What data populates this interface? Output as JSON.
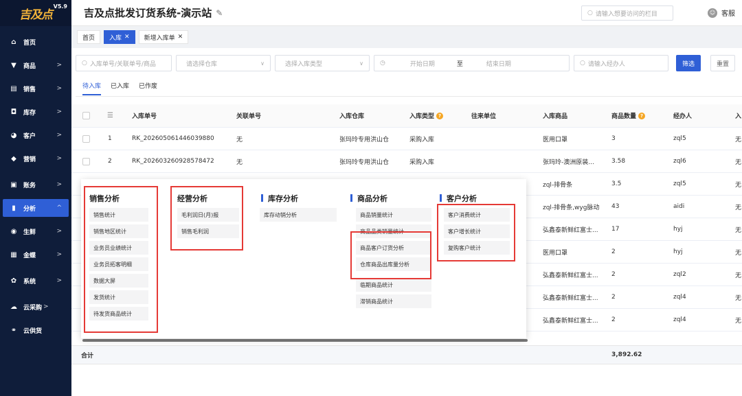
{
  "logo": {
    "text": "吉及点",
    "version": "V5.9"
  },
  "sidebar": {
    "items": [
      {
        "label": "首页",
        "icon": "home-icon",
        "glyph": "⌂"
      },
      {
        "label": "商品",
        "icon": "cart-icon",
        "glyph": "▼"
      },
      {
        "label": "销售",
        "icon": "sales-icon",
        "glyph": "▤"
      },
      {
        "label": "库存",
        "icon": "inventory-icon",
        "glyph": "◘"
      },
      {
        "label": "客户",
        "icon": "customer-icon",
        "glyph": "◕"
      },
      {
        "label": "营销",
        "icon": "marketing-icon",
        "glyph": "◆"
      },
      {
        "label": "账务",
        "icon": "ledger-icon",
        "glyph": "▣"
      },
      {
        "label": "分析",
        "icon": "chart-icon",
        "glyph": "▮"
      },
      {
        "label": "生鲜",
        "icon": "fresh-icon",
        "glyph": "◉"
      },
      {
        "label": "金蝶",
        "icon": "kingdee-icon",
        "glyph": "▦"
      },
      {
        "label": "系统",
        "icon": "gear-icon",
        "glyph": "✿"
      },
      {
        "label": "云采购",
        "icon": "cloud-icon",
        "glyph": "☁"
      },
      {
        "label": "云供货",
        "icon": "supply-icon",
        "glyph": "⚭"
      }
    ]
  },
  "header": {
    "title": "吉及点批发订货系统-演示站",
    "search_placeholder": "请输入想要访问的栏目",
    "service_label": "客服"
  },
  "tabs": [
    {
      "label": "首页"
    },
    {
      "label": "入库"
    },
    {
      "label": "新增入库单"
    }
  ],
  "filters": {
    "order_no": "入库单号/关联单号/商品",
    "warehouse": "请选择仓库",
    "in_type": "选择入库类型",
    "start_date": "开始日期",
    "date_sep": "至",
    "end_date": "结束日期",
    "operator": "请输入经办人",
    "search_btn": "筛选",
    "reset_btn": "重置"
  },
  "subtabs": [
    "待入库",
    "已入库",
    "已作废"
  ],
  "table": {
    "headers": [
      "入库单号",
      "关联单号",
      "入库仓库",
      "入库类型",
      "往来单位",
      "入库商品",
      "商品数量",
      "经办人",
      "入"
    ],
    "rows": [
      {
        "idx": "1",
        "no": "RK_202605061446039880",
        "rel": "无",
        "wh": "张玛玲专用洪山仓",
        "type": "采购入库",
        "goods": "医用口罩",
        "qty": "3",
        "op": "zql5",
        "last": "无"
      },
      {
        "idx": "2",
        "no": "RK_202603260928578472",
        "rel": "无",
        "wh": "张玛玲专用洪山仓",
        "type": "采购入库",
        "goods": "张玛玲-澳洲原装...",
        "qty": "3.58",
        "op": "zql6",
        "last": "无"
      },
      {
        "goods": "zql-排骨条",
        "qty": "3.5",
        "op": "zql5",
        "last": "无"
      },
      {
        "goods": "zql-排骨条,wyg脉动",
        "qty": "43",
        "op": "aidi",
        "last": "无"
      },
      {
        "goods": "弘鑫泰新鲜红富士...",
        "qty": "17",
        "op": "hyj",
        "last": "无"
      },
      {
        "goods": "医用口罩",
        "qty": "2",
        "op": "hyj",
        "last": "无"
      },
      {
        "goods": "弘鑫泰新鲜红富士...",
        "qty": "2",
        "op": "zql2",
        "last": "无"
      },
      {
        "goods": "弘鑫泰新鲜红富士...",
        "qty": "2",
        "op": "zql4",
        "last": "无"
      },
      {
        "goods": "弘鑫泰新鲜红富士...",
        "qty": "2",
        "op": "zql4",
        "last": "无"
      }
    ],
    "total_label": "合计",
    "total_qty": "3,892.62"
  },
  "popup": {
    "sales": {
      "title": "销售分析",
      "items": [
        "销售统计",
        "销售地区统计",
        "业务员业绩统计",
        "业务员拓客明细",
        "数据大屏",
        "发货统计",
        "待发货商品统计"
      ]
    },
    "operation": {
      "title": "经营分析",
      "items": [
        "毛利润日(月)报",
        "销售毛利润"
      ]
    },
    "inventory": {
      "title": "库存分析",
      "items": [
        "库存动销分析"
      ]
    },
    "goods": {
      "title": "商品分析",
      "items": [
        "商品销量统计",
        "商品品类销量统计",
        "商品客户订货分析",
        "仓库商品出库量分析",
        "临期商品统计",
        "滞销商品统计"
      ]
    },
    "customer": {
      "title": "客户分析",
      "items": [
        "客户消费统计",
        "客户增长统计",
        "复购客户统计"
      ]
    }
  },
  "colors": {
    "accent": "#2f5fd6",
    "sidebar_bg": "#0f1d3a",
    "highlight": "#e53935",
    "warn": "#f5a623"
  }
}
